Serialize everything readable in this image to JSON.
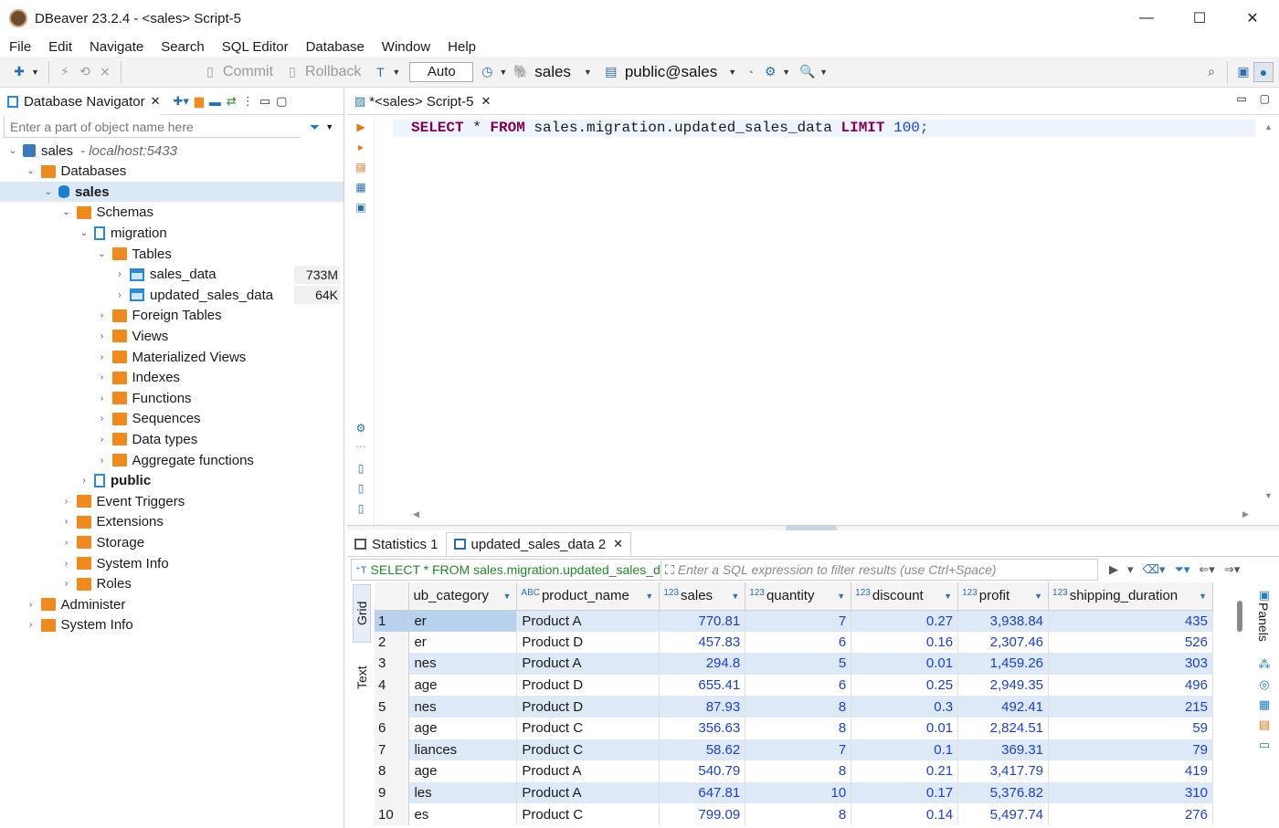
{
  "window": {
    "title": "DBeaver 23.2.4 - <sales> Script-5",
    "minimize": "—",
    "maximize": "☐",
    "close": "✕"
  },
  "menu": [
    "File",
    "Edit",
    "Navigate",
    "Search",
    "SQL Editor",
    "Database",
    "Window",
    "Help"
  ],
  "toolbar": {
    "commit_label": "Commit",
    "rollback_label": "Rollback",
    "tx_mode": "Auto",
    "connection": "sales",
    "schema": "public@sales"
  },
  "navigator": {
    "tab_label": "Database Navigator",
    "filter_placeholder": "Enter a part of object name here",
    "tree": [
      {
        "label": "sales",
        "suffix": "- localhost:5433",
        "level": 0,
        "chevron": "v",
        "icon": "server"
      },
      {
        "label": "Databases",
        "level": 1,
        "chevron": "v",
        "icon": "folder"
      },
      {
        "label": "sales",
        "level": 2,
        "chevron": "v",
        "icon": "db",
        "bold": true,
        "selected": true
      },
      {
        "label": "Schemas",
        "level": 3,
        "chevron": "v",
        "icon": "folder"
      },
      {
        "label": "migration",
        "level": 4,
        "chevron": "v",
        "icon": "schema"
      },
      {
        "label": "Tables",
        "level": 5,
        "chevron": "v",
        "icon": "folder"
      },
      {
        "label": "sales_data",
        "level": 6,
        "chevron": ">",
        "icon": "table",
        "size": "733M"
      },
      {
        "label": "updated_sales_data",
        "level": 6,
        "chevron": ">",
        "icon": "table",
        "size": "64K"
      },
      {
        "label": "Foreign Tables",
        "level": 5,
        "chevron": ">",
        "icon": "folder"
      },
      {
        "label": "Views",
        "level": 5,
        "chevron": ">",
        "icon": "folder"
      },
      {
        "label": "Materialized Views",
        "level": 5,
        "chevron": ">",
        "icon": "folder"
      },
      {
        "label": "Indexes",
        "level": 5,
        "chevron": ">",
        "icon": "folder"
      },
      {
        "label": "Functions",
        "level": 5,
        "chevron": ">",
        "icon": "folder"
      },
      {
        "label": "Sequences",
        "level": 5,
        "chevron": ">",
        "icon": "folder"
      },
      {
        "label": "Data types",
        "level": 5,
        "chevron": ">",
        "icon": "folder"
      },
      {
        "label": "Aggregate functions",
        "level": 5,
        "chevron": ">",
        "icon": "folder"
      },
      {
        "label": "public",
        "level": 4,
        "chevron": ">",
        "icon": "schema",
        "bold": true
      },
      {
        "label": "Event Triggers",
        "level": 3,
        "chevron": ">",
        "icon": "folder"
      },
      {
        "label": "Extensions",
        "level": 3,
        "chevron": ">",
        "icon": "folder"
      },
      {
        "label": "Storage",
        "level": 3,
        "chevron": ">",
        "icon": "folder"
      },
      {
        "label": "System Info",
        "level": 3,
        "chevron": ">",
        "icon": "folder"
      },
      {
        "label": "Roles",
        "level": 3,
        "chevron": ">",
        "icon": "folder"
      },
      {
        "label": "Administer",
        "level": 1,
        "chevron": ">",
        "icon": "folder"
      },
      {
        "label": "System Info",
        "level": 1,
        "chevron": ">",
        "icon": "folder"
      }
    ]
  },
  "editor": {
    "tab_label": "*<sales> Script-5",
    "sql": {
      "kw_select": "SELECT",
      "star": " * ",
      "kw_from": "FROM",
      "table": " sales.migration.updated_sales_data ",
      "kw_limit": "LIMIT",
      "limit": " 100",
      "semi": ";"
    }
  },
  "results": {
    "tabs": [
      "Statistics 1",
      "updated_sales_data 2"
    ],
    "query_text": "SELECT * FROM sales.migration.updated_sales_data",
    "filter_placeholder": "Enter a SQL expression to filter results (use Ctrl+Space)",
    "vtab_grid": "Grid",
    "vtab_text": "Text",
    "panels_label": "Panels",
    "columns": [
      {
        "type": "",
        "name": "ub_category"
      },
      {
        "type": "ABC",
        "name": "product_name"
      },
      {
        "type": "123",
        "name": "sales"
      },
      {
        "type": "123",
        "name": "quantity"
      },
      {
        "type": "123",
        "name": "discount"
      },
      {
        "type": "123",
        "name": "profit"
      },
      {
        "type": "123",
        "name": "shipping_duration"
      }
    ],
    "rows": [
      [
        "1",
        "er",
        "Product A",
        "770.81",
        "7",
        "0.27",
        "3,938.84",
        "435"
      ],
      [
        "2",
        "er",
        "Product D",
        "457.83",
        "6",
        "0.16",
        "2,307.46",
        "526"
      ],
      [
        "3",
        "nes",
        "Product A",
        "294.8",
        "5",
        "0.01",
        "1,459.26",
        "303"
      ],
      [
        "4",
        "age",
        "Product D",
        "655.41",
        "6",
        "0.25",
        "2,949.35",
        "496"
      ],
      [
        "5",
        "nes",
        "Product D",
        "87.93",
        "8",
        "0.3",
        "492.41",
        "215"
      ],
      [
        "6",
        "age",
        "Product C",
        "356.63",
        "8",
        "0.01",
        "2,824.51",
        "59"
      ],
      [
        "7",
        "liances",
        "Product C",
        "58.62",
        "7",
        "0.1",
        "369.31",
        "79"
      ],
      [
        "8",
        "age",
        "Product A",
        "540.79",
        "8",
        "0.21",
        "3,417.79",
        "419"
      ],
      [
        "9",
        "les",
        "Product A",
        "647.81",
        "10",
        "0.17",
        "5,376.82",
        "310"
      ],
      [
        "10",
        "es",
        "Product C",
        "799.09",
        "8",
        "0.14",
        "5,497.74",
        "276"
      ]
    ]
  }
}
